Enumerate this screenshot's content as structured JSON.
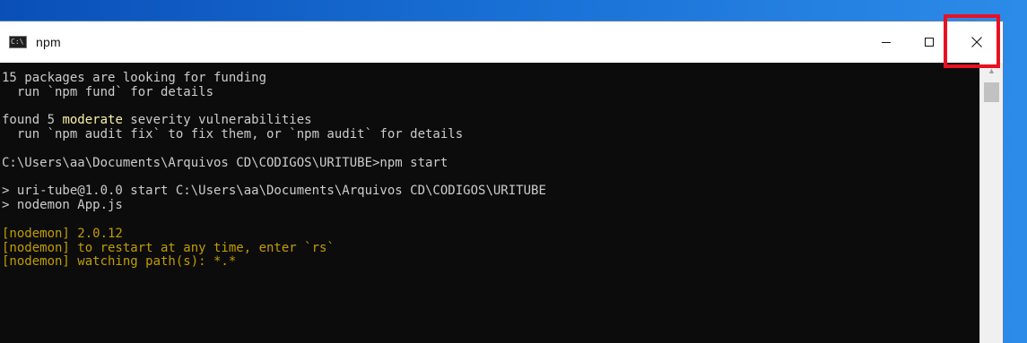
{
  "window": {
    "title": "npm",
    "icon_label": "C:\\"
  },
  "console": {
    "lines": [
      [
        {
          "t": "15 packages are looking for funding"
        }
      ],
      [
        {
          "t": "  run `npm fund` for details"
        }
      ],
      [
        {
          "t": ""
        }
      ],
      [
        {
          "t": "found 5 "
        },
        {
          "t": "moderate",
          "c": "yellow"
        },
        {
          "t": " severity vulnerabilities"
        }
      ],
      [
        {
          "t": "  run `npm audit fix` to fix them, or `npm audit` for details"
        }
      ],
      [
        {
          "t": ""
        }
      ],
      [
        {
          "t": "C:\\Users\\aa\\Documents\\Arquivos CD\\CODIGOS\\URITUBE>npm start"
        }
      ],
      [
        {
          "t": ""
        }
      ],
      [
        {
          "t": "> uri-tube@1.0.0 start C:\\Users\\aa\\Documents\\Arquivos CD\\CODIGOS\\URITUBE"
        }
      ],
      [
        {
          "t": "> nodemon App.js"
        }
      ],
      [
        {
          "t": ""
        }
      ],
      [
        {
          "t": "[nodemon] 2.0.12",
          "c": "gold"
        }
      ],
      [
        {
          "t": "[nodemon] to restart at any time, enter `rs`",
          "c": "gold"
        }
      ],
      [
        {
          "t": "[nodemon] watching path(s): *.*",
          "c": "gold"
        }
      ]
    ]
  },
  "colors": {
    "text": "#cccccc",
    "highlight": "#f9f1a5",
    "nodemon": "#c19c00",
    "annotation_box": "#e81123"
  }
}
